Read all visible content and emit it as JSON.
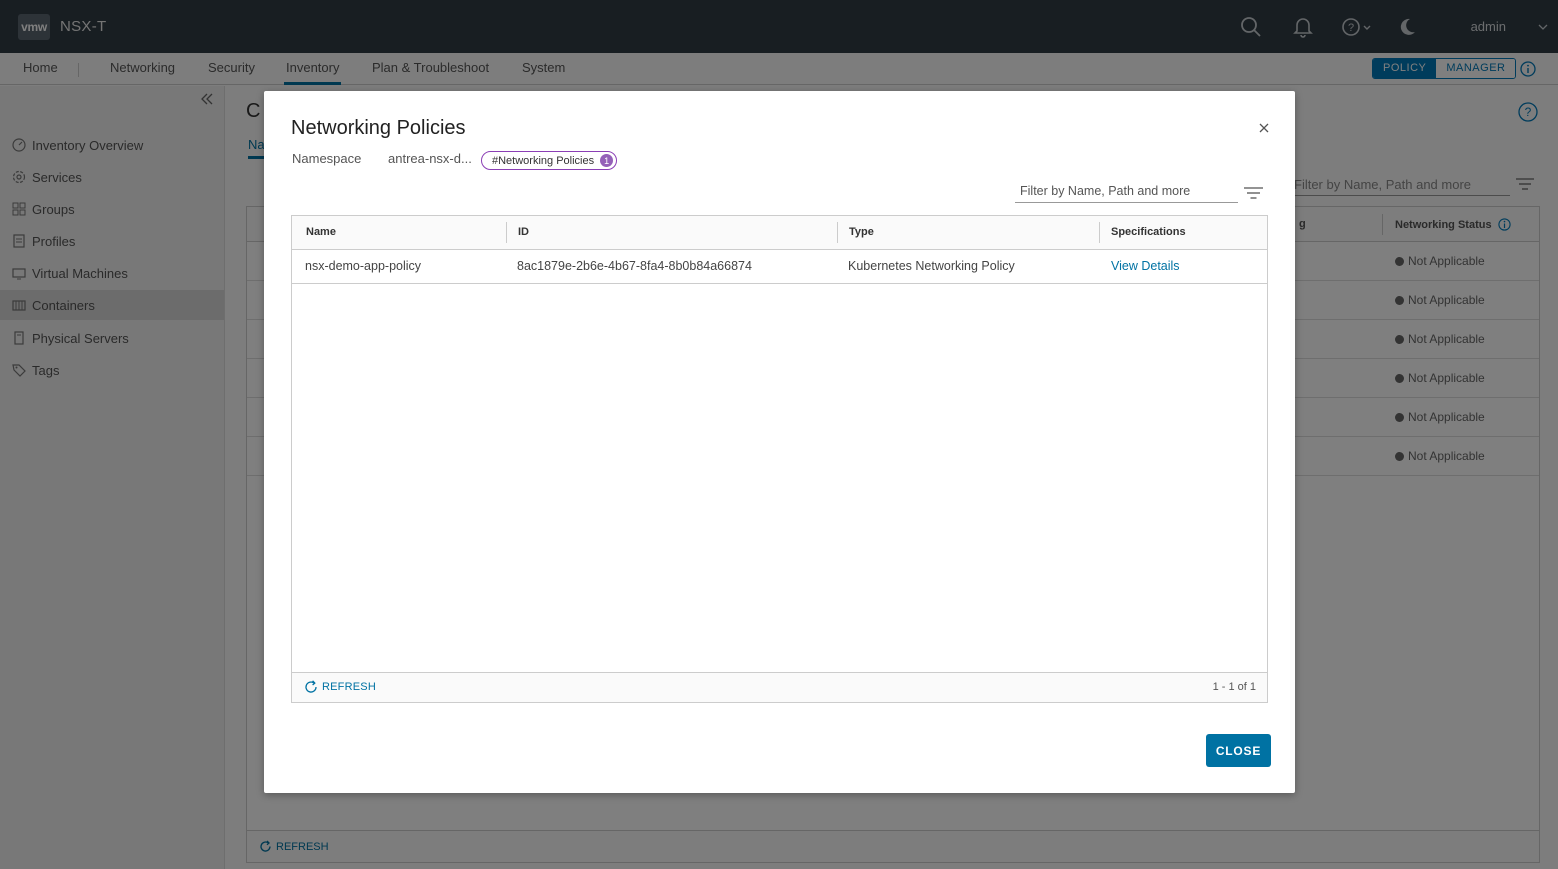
{
  "header": {
    "logo": "vmw",
    "app_title": "NSX-T",
    "user": "admin",
    "icons": [
      "search-icon",
      "bell-icon",
      "help-icon",
      "moon-icon"
    ]
  },
  "nav": {
    "items": [
      "Home",
      "Networking",
      "Security",
      "Inventory",
      "Plan & Troubleshoot",
      "System"
    ],
    "active": "Inventory",
    "mode_policy": "POLICY",
    "mode_manager": "MANAGER"
  },
  "sidebar": {
    "items": [
      {
        "label": "Inventory Overview",
        "icon": "gauge-icon"
      },
      {
        "label": "Services",
        "icon": "services-icon"
      },
      {
        "label": "Groups",
        "icon": "groups-icon"
      },
      {
        "label": "Profiles",
        "icon": "profile-icon"
      },
      {
        "label": "Virtual Machines",
        "icon": "vm-icon"
      },
      {
        "label": "Containers",
        "icon": "containers-icon"
      },
      {
        "label": "Physical Servers",
        "icon": "server-icon"
      },
      {
        "label": "Tags",
        "icon": "tag-icon"
      }
    ],
    "active": "Containers"
  },
  "background": {
    "title_partial": "C",
    "tab_partial": "Na",
    "filter_placeholder": "Filter by Name, Path and more",
    "col_partial": "g",
    "networking_status_header": "Networking Status",
    "statuses": [
      "Not Applicable",
      "Not Applicable",
      "Not Applicable",
      "Not Applicable",
      "Not Applicable",
      "Not Applicable"
    ],
    "refresh": "REFRESH"
  },
  "modal": {
    "title": "Networking Policies",
    "namespace_label": "Namespace",
    "namespace_value": "antrea-nsx-d...",
    "tag_label": "#Networking Policies",
    "tag_count": "1",
    "filter_placeholder": "Filter by Name, Path and more",
    "columns": [
      "Name",
      "ID",
      "Type",
      "Specifications"
    ],
    "rows": [
      {
        "name": "nsx-demo-app-policy",
        "id": "8ac1879e-2b6e-4b67-8fa4-8b0b84a66874",
        "type": "Kubernetes Networking Policy",
        "spec": "View Details"
      }
    ],
    "refresh": "REFRESH",
    "pagination": "1 - 1 of 1",
    "close_button": "CLOSE"
  }
}
